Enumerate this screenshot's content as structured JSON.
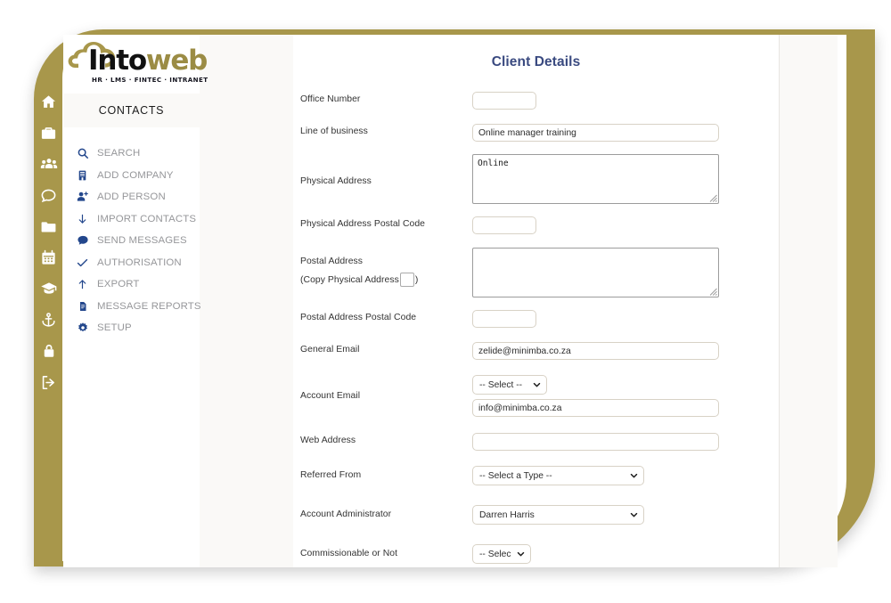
{
  "brand": {
    "logo_text_part1": "Into",
    "logo_text_part2": "web",
    "logo_tagline": "HR · LMS · FINTEC · INTRANET",
    "gold_color": "#a8974b",
    "accent_blue": "#3a4a80",
    "menu_icon_color": "#23478c"
  },
  "icon_rail": {
    "items": [
      {
        "name": "home-icon"
      },
      {
        "name": "briefcase-icon"
      },
      {
        "name": "users-icon"
      },
      {
        "name": "chat-bubble-icon"
      },
      {
        "name": "folder-icon"
      },
      {
        "name": "calendar-icon"
      },
      {
        "name": "graduation-cap-icon"
      },
      {
        "name": "anchor-icon"
      },
      {
        "name": "lock-icon"
      },
      {
        "name": "sign-out-icon"
      }
    ]
  },
  "sidebar": {
    "section_title": "CONTACTS",
    "items": [
      {
        "label": "SEARCH",
        "icon": "search-icon"
      },
      {
        "label": "ADD COMPANY",
        "icon": "building-icon"
      },
      {
        "label": "ADD PERSON",
        "icon": "user-plus-icon"
      },
      {
        "label": "IMPORT CONTACTS",
        "icon": "arrow-down-icon"
      },
      {
        "label": "SEND MESSAGES",
        "icon": "message-icon"
      },
      {
        "label": "AUTHORISATION",
        "icon": "check-icon"
      },
      {
        "label": "EXPORT",
        "icon": "arrow-up-icon"
      },
      {
        "label": "MESSAGE REPORTS",
        "icon": "document-icon"
      },
      {
        "label": "SETUP",
        "icon": "gear-icon"
      }
    ]
  },
  "form": {
    "title": "Client Details",
    "fields": {
      "office_number": {
        "label": "Office Number",
        "value": "",
        "placeholder": ""
      },
      "line_of_business": {
        "label": "Line of business",
        "value": "Online manager training",
        "placeholder": ""
      },
      "physical_address": {
        "label": "Physical Address",
        "value": "Online",
        "placeholder": ""
      },
      "physical_postal_code": {
        "label": "Physical Address Postal Code",
        "value": "",
        "placeholder": ""
      },
      "postal_address": {
        "label": "Postal Address",
        "copy_label_open": "(Copy Physical Address",
        "copy_label_close": ")",
        "value": "",
        "placeholder": "",
        "checked": false
      },
      "postal_postal_code": {
        "label": "Postal Address Postal Code",
        "value": "",
        "placeholder": ""
      },
      "general_email": {
        "label": "General Email",
        "value": "zelide@minimba.co.za",
        "placeholder": ""
      },
      "account_email": {
        "label": "Account Email",
        "select_value": "-- Select --",
        "value": "info@minimba.co.za",
        "placeholder": ""
      },
      "web_address": {
        "label": "Web Address",
        "value": "",
        "placeholder": ""
      },
      "referred_from": {
        "label": "Referred From",
        "select_value": "-- Select a Type --"
      },
      "account_administrator": {
        "label": "Account Administrator",
        "select_value": "Darren Harris"
      },
      "commissionable": {
        "label": "Commissionable or Not",
        "select_value": "-- Selec"
      }
    }
  }
}
